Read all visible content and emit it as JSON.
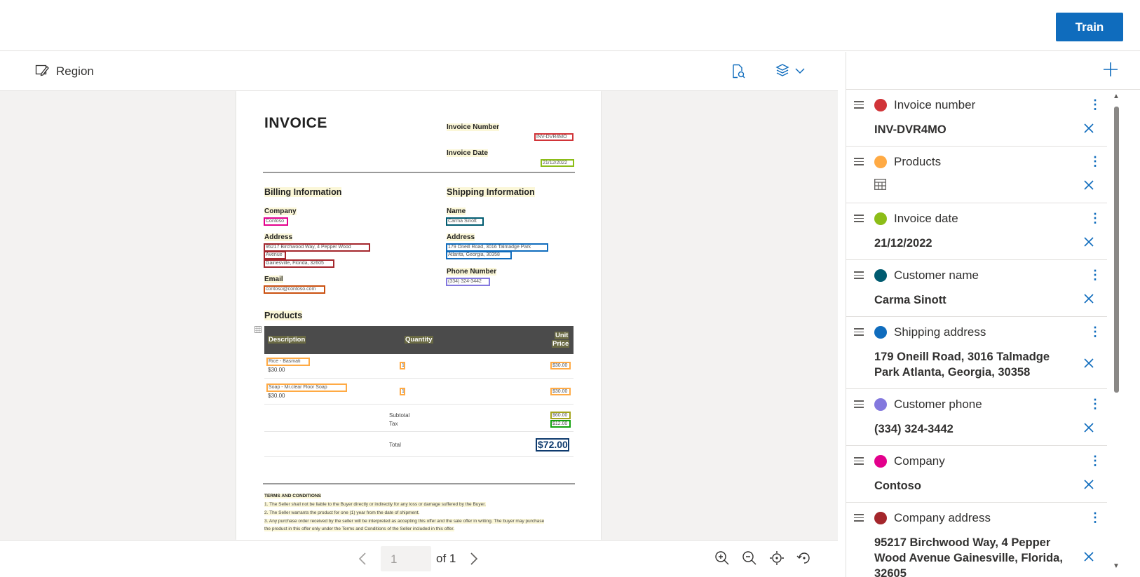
{
  "topbar": {
    "train_label": "Train"
  },
  "toolbar": {
    "region_label": "Region"
  },
  "document": {
    "title": "INVOICE",
    "invoice_number_label": "Invoice Number",
    "invoice_number_value": "INV-DVR4MO",
    "invoice_date_label": "Invoice Date",
    "invoice_date_value": "21/12/2022",
    "billing_heading": "Billing Information",
    "shipping_heading": "Shipping Information",
    "company_label": "Company",
    "company_value": "Contoso",
    "name_label": "Name",
    "name_value": "Carma Sinott",
    "address_label": "Address",
    "billing_address_line1": "95217 Birchwood Way, 4 Pepper Wood",
    "billing_address_line2": "Avenue",
    "billing_address_line3": "Gainesville, Florida, 32605",
    "shipping_address_line1": "179 Oneill Road, 3016 Talmadge Park",
    "shipping_address_line2": "Atlanta, Georgia, 30358",
    "email_label": "Email",
    "email_value": "contoso@contoso.com",
    "phone_label": "Phone Number",
    "phone_value": "(334) 324-3442",
    "products_heading": "Products",
    "col_description": "Description",
    "col_quantity": "Quantity",
    "col_unit_price_1": "Unit",
    "col_unit_price_2": "Price",
    "rows": [
      {
        "desc": "Rice - Basmati",
        "sub": "$30.00",
        "qty": "1",
        "price": "$30.00"
      },
      {
        "desc": "Soap - Mr.clear Floor Soap",
        "sub": "$30.00",
        "qty": "1",
        "price": "$30.00"
      }
    ],
    "subtotal_label": "Subtotal",
    "subtotal_value": "$60.00",
    "tax_label": "Tax",
    "tax_value": "$12.00",
    "total_label": "Total",
    "total_value": "$72.00",
    "terms_heading": "TERMS AND CONDITIONS",
    "terms_1": "1. The Seller shall not be liable to the Buyer directly or indirectly for any loss or damage suffered by the Buyer.",
    "terms_2": "2. The Seller warrants the product for one (1) year from the date of shipment.",
    "terms_3": "3. Any purchase order received by the seller will be interpreted as accepting this offer and the sale offer in writing. The buyer may purchase",
    "terms_4": "the product in this offer only under the Terms and Conditions of the Seller included in this offer."
  },
  "pager": {
    "current_page": "1",
    "of_label": "of 1"
  },
  "fields": [
    {
      "name": "Invoice number",
      "value": "INV-DVR4MO",
      "color": "#d13438"
    },
    {
      "name": "Products",
      "value": "",
      "color": "#ffaa44",
      "is_table": true
    },
    {
      "name": "Invoice date",
      "value": "21/12/2022",
      "color": "#8cbd18"
    },
    {
      "name": "Customer name",
      "value": "Carma Sinott",
      "color": "#005b70"
    },
    {
      "name": "Shipping address",
      "value": "179 Oneill Road, 3016 Talmadge Park Atlanta, Georgia, 30358",
      "color": "#0f6cbd"
    },
    {
      "name": "Customer phone",
      "value": "(334) 324-3442",
      "color": "#8378de"
    },
    {
      "name": "Company",
      "value": "Contoso",
      "color": "#e3008c"
    },
    {
      "name": "Company address",
      "value": "95217 Birchwood Way, 4 Pepper Wood Avenue Gainesville, Florida, 32605",
      "color": "#a4262c"
    }
  ]
}
